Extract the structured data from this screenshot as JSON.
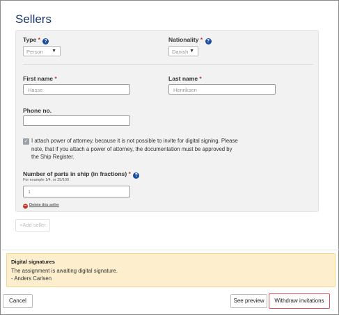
{
  "section": {
    "title": "Sellers"
  },
  "fields": {
    "type": {
      "label": "Type",
      "required": "*",
      "value": "Person"
    },
    "nationality": {
      "label": "Nationality",
      "required": "*",
      "value": "Danish"
    },
    "first_name": {
      "label": "First name",
      "required": "*",
      "value": "Hasse"
    },
    "last_name": {
      "label": "Last name",
      "required": "*",
      "value": "Henriksen"
    },
    "phone": {
      "label": "Phone no.",
      "value": ""
    },
    "poa_checkbox": {
      "checked": true,
      "text": "I attach power of attorney, because it is not possible to invite for digital signing. Please note, that if you attach a power of attorney, the documentation must be approved by the Ship Register."
    },
    "parts": {
      "label": "Number of parts in ship (in fractions)",
      "required": "*",
      "hint": "For example 1/4, or 25/100",
      "value": "1"
    }
  },
  "delete_seller": "Delete this seller",
  "add_seller": "+Add seller",
  "notice": {
    "title": "Digital signatures",
    "line1": "The assignment is awaiting digital signature.",
    "line2": "- Anders Carlsen"
  },
  "footer": {
    "cancel": "Cancel",
    "preview": "See preview",
    "withdraw": "Withdraw invitations"
  },
  "icons": {
    "help": "question-icon",
    "delete": "minus-circle-icon",
    "chevron": "chevron-down-icon",
    "check": "check-icon"
  },
  "colors": {
    "title": "#1b3a6b",
    "help": "#1c4e9e",
    "required": "#c0392b",
    "notice_bg": "#fdefcd",
    "highlight": "#d6515a"
  }
}
